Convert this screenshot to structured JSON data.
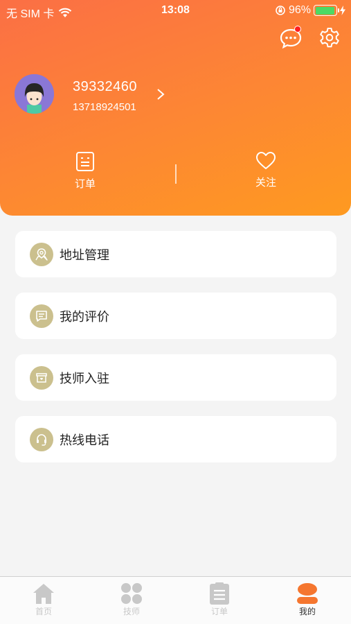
{
  "status_bar": {
    "carrier": "无 SIM 卡",
    "time": "13:08",
    "battery": "96%",
    "battery_level": 0.96
  },
  "header": {
    "icons": [
      "message-icon",
      "settings-icon"
    ],
    "username": "39332460",
    "phone": "13718924501",
    "stats": {
      "orders_label": "订单",
      "follow_label": "关注"
    }
  },
  "menu": {
    "items": [
      {
        "label": "地址管理",
        "icon": "location-icon"
      },
      {
        "label": "我的评价",
        "icon": "comment-icon"
      },
      {
        "label": "技师入驻",
        "icon": "store-icon"
      },
      {
        "label": "热线电话",
        "icon": "headset-icon"
      }
    ]
  },
  "tabbar": {
    "tabs": [
      {
        "label": "首页",
        "icon": "home-icon"
      },
      {
        "label": "技师",
        "icon": "grid-icon"
      },
      {
        "label": "订单",
        "icon": "order-icon"
      },
      {
        "label": "我的",
        "icon": "profile-icon"
      }
    ],
    "active_index": 3
  },
  "colors": {
    "header_gradient_start": "#fb6f45",
    "header_gradient_end": "#fe9a20",
    "menu_icon_bg": "#cbc08e",
    "tab_active": "#f5762f",
    "tab_inactive": "#c8c8c8"
  }
}
